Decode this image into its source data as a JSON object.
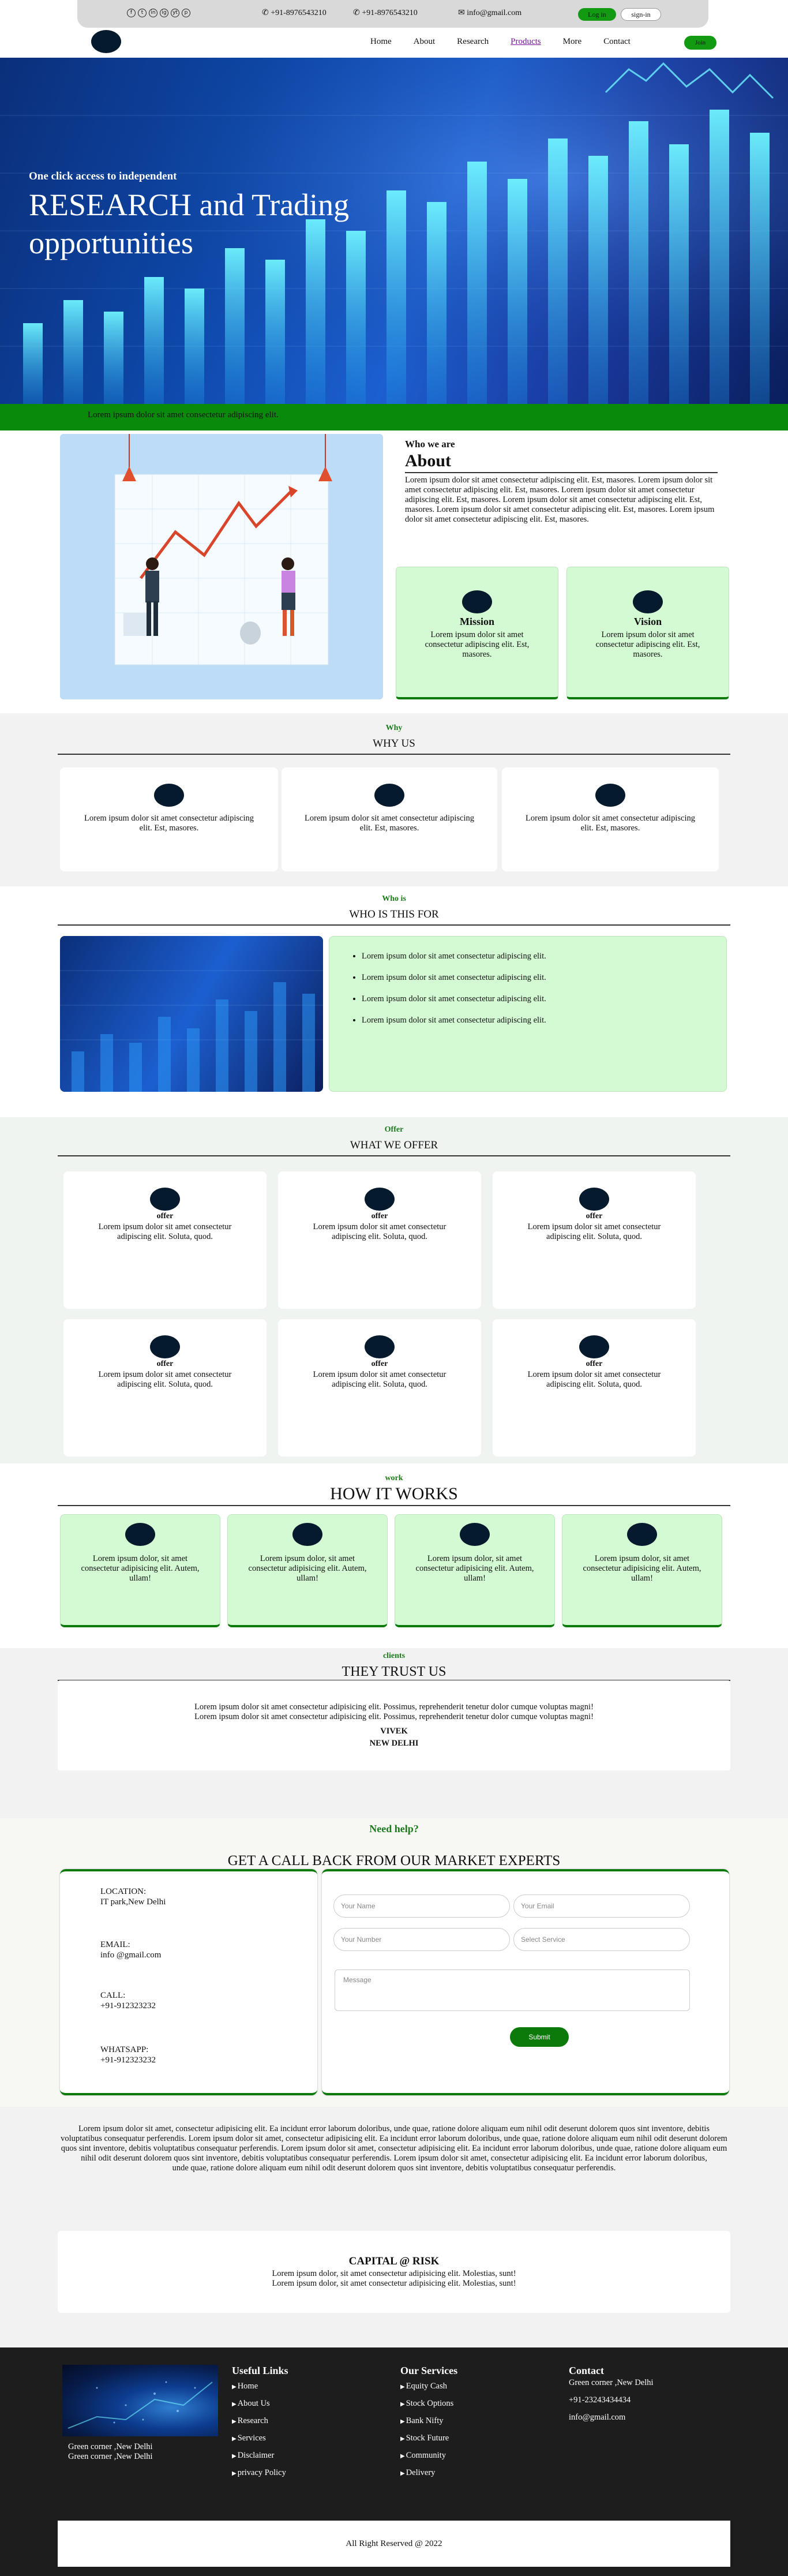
{
  "topbar": {
    "socials": [
      "f",
      "t",
      "in",
      "ig",
      "yt",
      "p"
    ],
    "phone1": "+91-8976543210",
    "phone2": "+91-8976543210",
    "email": "info@gmail.com",
    "login_label": "Log in",
    "signin_label": "sign-in"
  },
  "nav": {
    "items": [
      "Home",
      "About",
      "Research",
      "Products",
      "More",
      "Contact"
    ],
    "active": "Products",
    "join_label": "Join"
  },
  "hero": {
    "small": "One click access to independent",
    "big": "RESEARCH and Trading opportunities"
  },
  "ticker": {
    "text": "Lorem ipsum dolor sit amet consectetur adipiscing elit."
  },
  "about": {
    "kicker": "Who we are",
    "title": "About",
    "text": "Lorem ipsum dolor sit amet consectetur adipiscing elit. Est, masores. Lorem ipsum dolor sit amet consectetur adipiscing elit. Est, masores. Lorem ipsum dolor sit amet consectetur adipiscing elit. Est, masores. Lorem ipsum dolor sit amet consectetur adipiscing elit. Est, masores. Lorem ipsum dolor sit amet consectetur adipiscing elit. Est, masores. Lorem ipsum dolor sit amet consectetur adipiscing elit. Est, masores.",
    "mission_title": "Mission",
    "mission_text": "Lorem ipsum dolor sit amet consectetur adipiscing elit. Est, masores.",
    "vision_title": "Vision",
    "vision_text": "Lorem ipsum dolor sit amet consectetur adipiscing elit. Est, masores."
  },
  "why": {
    "kicker": "Why",
    "title": "WHY US",
    "cards": [
      "Lorem ipsum dolor sit amet consectetur adipiscing elit. Est, masores.",
      "Lorem ipsum dolor sit amet consectetur adipiscing elit. Est, masores.",
      "Lorem ipsum dolor sit amet consectetur adipiscing elit. Est, masores."
    ]
  },
  "who": {
    "kicker": "Who is",
    "title": "WHO IS THIS FOR",
    "items": [
      "Lorem ipsum dolor sit amet consectetur adipiscing elit.",
      "Lorem ipsum dolor sit amet consectetur adipiscing elit.",
      "Lorem ipsum dolor sit amet consectetur adipiscing elit.",
      "Lorem ipsum dolor sit amet consectetur adipiscing elit."
    ]
  },
  "offer": {
    "kicker": "Offer",
    "title": "WHAT WE OFFER",
    "card_title": "offer",
    "card_text": "Lorem ipsum dolor sit amet consectetur adipiscing elit. Soluta, quod."
  },
  "how": {
    "kicker": "work",
    "title": "HOW IT WORKS",
    "card_text": "Lorem ipsum dolor, sit amet consectetur adipisicing elit. Autem, ullam!"
  },
  "clients": {
    "kicker": "clients",
    "title": "THEY TRUST US",
    "line1": "Lorem ipsum dolor sit amet consectetur adipisicing elit. Possimus, reprehenderit tenetur dolor cumque voluptas magni!",
    "line2": "Lorem ipsum dolor sit amet consectetur adipisicing elit. Possimus, reprehenderit tenetur dolor cumque voluptas magni!",
    "name": "VIVEK",
    "location": "NEW DELHI"
  },
  "callback": {
    "help": "Need help?",
    "title": "GET A CALL BACK FROM OUR MARKET EXPERTS",
    "location_label": "LOCATION:",
    "location_value": "IT park,New Delhi",
    "email_label": "EMAIL:",
    "email_value": "info @gmail.com",
    "call_label": "CALL:",
    "call_value": "+91-912323232",
    "whatsapp_label": "WHATSAPP:",
    "whatsapp_value": "+91-912323232",
    "name_placeholder": "Your Name",
    "email_placeholder": "Your Email",
    "number_placeholder": "Your Number",
    "service_placeholder": "Select Service",
    "message_placeholder": "Message",
    "submit_label": "Submit"
  },
  "long_para": {
    "line1": "Lorem ipsum dolor sit amet, consectetur adipisicing elit. Ea incidunt error laborum doloribus, unde quae, ratione dolore aliquam eum nihil odit deserunt dolorem quos sint inventore, debitis voluptatibus consequatur perferendis. Lorem ipsum dolor sit amet, consectetur adipisicing elit. Ea incidunt error laborum doloribus, unde quae, ratione dolore aliquam eum nihil odit deserunt dolorem quos sint inventore, debitis voluptatibus consequatur perferendis. Lorem ipsum dolor sit amet, consectetur adipisicing elit. Ea incidunt error laborum doloribus, unde quae, ratione dolore aliquam eum nihil odit deserunt dolorem quos sint inventore, debitis voluptatibus consequatur perferendis. Lorem ipsum dolor sit amet, consectetur adipisicing elit. Ea incidunt error laborum doloribus,",
    "line2": "unde quae, ratione dolore aliquam eum nihil odit deserunt dolorem quos sint inventore, debitis voluptatibus consequatur perferendis."
  },
  "risk": {
    "title": "CAPITAL @ RISK",
    "line1": "Lorem ipsum dolor, sit amet consectetur adipisicing elit. Molestias, sunt!",
    "line2": "Lorem ipsum dolor, sit amet consectetur adipisicing elit. Molestias, sunt!"
  },
  "footer": {
    "address1": "Green corner ,New Delhi",
    "address2": "Green corner ,New Delhi",
    "links_title": "Useful Links",
    "links": [
      "Home",
      "About Us",
      "Research",
      "Services",
      "Disclaimer",
      "privacy Policy"
    ],
    "services_title": "Our Services",
    "services": [
      "Equity Cash",
      "Stock Options",
      "Bank Nifty",
      "Stock Future",
      "Community",
      "Delivery"
    ],
    "contact_title": "Contact",
    "contact": [
      "Green corner ,New Delhi",
      "+91-23243434434",
      "info@gmail.com"
    ],
    "copyright": "All Right Reserved @ 2022"
  }
}
